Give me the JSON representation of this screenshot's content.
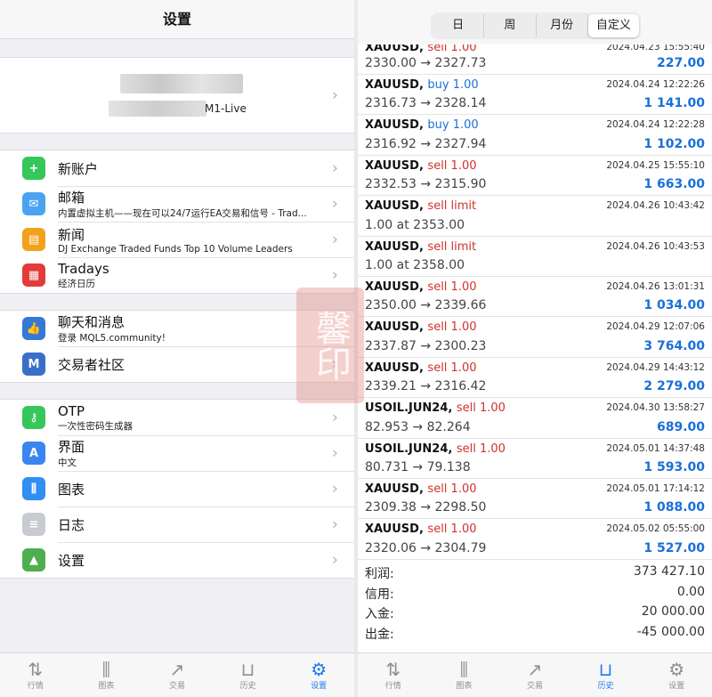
{
  "left": {
    "header_title": "设置",
    "account_label": "M1-Live",
    "group1": [
      {
        "title": "新账户",
        "sub": "",
        "icon": "add-user-icon",
        "color": "#35c759"
      },
      {
        "title": "邮箱",
        "sub": "内置虚拟主机——现在可以24/7运行EA交易和信号 - Trad...",
        "icon": "mail-icon",
        "color": "#4aa3f0"
      },
      {
        "title": "新闻",
        "sub": "DJ Exchange Traded Funds Top 10 Volume Leaders",
        "icon": "news-book-icon",
        "color": "#f2a11c"
      },
      {
        "title": "Tradays",
        "sub": "经济日历",
        "icon": "calendar-icon",
        "color": "#e23b3b"
      }
    ],
    "group2": [
      {
        "title": "聊天和消息",
        "sub": "登录 MQL5.community!",
        "icon": "thumbs-up-icon",
        "color": "#3478d8"
      },
      {
        "title": "交易者社区",
        "sub": "",
        "icon": "mql5-icon",
        "color": "#3a6fc7"
      }
    ],
    "group3": [
      {
        "title": "OTP",
        "sub": "一次性密码生成器",
        "icon": "key-icon",
        "color": "#35c759"
      },
      {
        "title": "界面",
        "sub": "中文",
        "icon": "translate-icon",
        "color": "#3a86f0"
      },
      {
        "title": "图表",
        "sub": "",
        "icon": "candlestick-icon",
        "color": "#2f8ff2"
      },
      {
        "title": "日志",
        "sub": "",
        "icon": "log-icon",
        "color": "#c8cbd1"
      },
      {
        "title": "设置",
        "sub": "",
        "icon": "settings-app-icon",
        "color": "#4fae4f"
      }
    ],
    "tabs": [
      {
        "label": "行情",
        "icon": "quotes-icon",
        "glyph": "⇅",
        "active": false
      },
      {
        "label": "图表",
        "icon": "chart-icon",
        "glyph": "⫼",
        "active": false
      },
      {
        "label": "交易",
        "icon": "trade-icon",
        "glyph": "↗",
        "active": false
      },
      {
        "label": "历史",
        "icon": "history-icon",
        "glyph": "⊔",
        "active": false
      },
      {
        "label": "设置",
        "icon": "gear-icon",
        "glyph": "⚙",
        "active": true
      }
    ]
  },
  "right": {
    "segments": [
      "日",
      "周",
      "月份",
      "自定义"
    ],
    "active_segment": 3,
    "deals": [
      {
        "sym": "XAUUSD,",
        "side": "sell 1.00",
        "type": "sell",
        "dt": "2024.04.23 15:55:40",
        "px": "2330.00 → 2327.73",
        "pr": "227.00"
      },
      {
        "sym": "XAUUSD,",
        "side": "buy 1.00",
        "type": "buy",
        "dt": "2024.04.24 12:22:26",
        "px": "2316.73 → 2328.14",
        "pr": "1 141.00"
      },
      {
        "sym": "XAUUSD,",
        "side": "buy 1.00",
        "type": "buy",
        "dt": "2024.04.24 12:22:28",
        "px": "2316.92 → 2327.94",
        "pr": "1 102.00"
      },
      {
        "sym": "XAUUSD,",
        "side": "sell 1.00",
        "type": "sell",
        "dt": "2024.04.25 15:55:10",
        "px": "2332.53 → 2315.90",
        "pr": "1 663.00"
      },
      {
        "sym": "XAUUSD,",
        "side": "sell limit",
        "type": "sell",
        "dt": "2024.04.26 10:43:42",
        "px": "1.00 at 2353.00",
        "pr": ""
      },
      {
        "sym": "XAUUSD,",
        "side": "sell limit",
        "type": "sell",
        "dt": "2024.04.26 10:43:53",
        "px": "1.00 at 2358.00",
        "pr": ""
      },
      {
        "sym": "XAUUSD,",
        "side": "sell 1.00",
        "type": "sell",
        "dt": "2024.04.26 13:01:31",
        "px": "2350.00 → 2339.66",
        "pr": "1 034.00"
      },
      {
        "sym": "XAUUSD,",
        "side": "sell 1.00",
        "type": "sell",
        "dt": "2024.04.29 12:07:06",
        "px": "2337.87 → 2300.23",
        "pr": "3 764.00"
      },
      {
        "sym": "XAUUSD,",
        "side": "sell 1.00",
        "type": "sell",
        "dt": "2024.04.29 14:43:12",
        "px": "2339.21 → 2316.42",
        "pr": "2 279.00"
      },
      {
        "sym": "USOIL.JUN24,",
        "side": "sell 1.00",
        "type": "sell",
        "dt": "2024.04.30 13:58:27",
        "px": "82.953 → 82.264",
        "pr": "689.00"
      },
      {
        "sym": "USOIL.JUN24,",
        "side": "sell 1.00",
        "type": "sell",
        "dt": "2024.05.01 14:37:48",
        "px": "80.731 → 79.138",
        "pr": "1 593.00"
      },
      {
        "sym": "XAUUSD,",
        "side": "sell 1.00",
        "type": "sell",
        "dt": "2024.05.01 17:14:12",
        "px": "2309.38 → 2298.50",
        "pr": "1 088.00"
      },
      {
        "sym": "XAUUSD,",
        "side": "sell 1.00",
        "type": "sell",
        "dt": "2024.05.02 05:55:00",
        "px": "2320.06 → 2304.79",
        "pr": "1 527.00"
      }
    ],
    "summary": [
      {
        "label": "利润:",
        "value": "373 427.10"
      },
      {
        "label": "信用:",
        "value": "0.00"
      },
      {
        "label": "入金:",
        "value": "20 000.00"
      },
      {
        "label": "出金:",
        "value": "-45 000.00"
      }
    ],
    "tabs": [
      {
        "label": "行情",
        "icon": "quotes-icon",
        "glyph": "⇅",
        "active": false
      },
      {
        "label": "图表",
        "icon": "chart-icon",
        "glyph": "⫼",
        "active": false
      },
      {
        "label": "交易",
        "icon": "trade-icon",
        "glyph": "↗",
        "active": false
      },
      {
        "label": "历史",
        "icon": "history-icon",
        "glyph": "⊔",
        "active": true
      },
      {
        "label": "设置",
        "icon": "gear-icon",
        "glyph": "⚙",
        "active": false
      }
    ]
  },
  "watermark": "馨印",
  "colors": {
    "accent": "#1a7cf0",
    "sell": "#d0312d",
    "buy": "#1a6fd9",
    "profit": "#1a6fd9"
  }
}
